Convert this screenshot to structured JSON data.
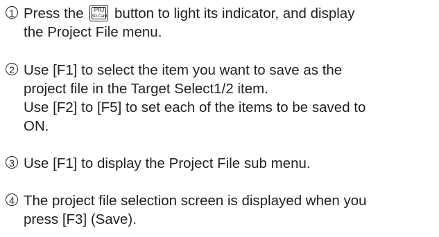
{
  "steps": [
    {
      "number": "1",
      "lines": [
        [
          "Press the",
          "button to light its indicator, and display"
        ],
        "the Project File menu."
      ],
      "key": {
        "top": "PRJ",
        "bottom": "SD Card"
      }
    },
    {
      "number": "2",
      "lines": [
        "Use [F1] to select the item you want to save as the",
        "project file in the Target Select1/2 item.",
        "Use [F2] to [F5] to set each of the items to be saved to",
        "ON."
      ]
    },
    {
      "number": "3",
      "lines": [
        "Use [F1] to display the Project File sub menu."
      ]
    },
    {
      "number": "4",
      "lines": [
        "The project file selection screen is displayed when you",
        "press [F3] (Save)."
      ]
    }
  ]
}
